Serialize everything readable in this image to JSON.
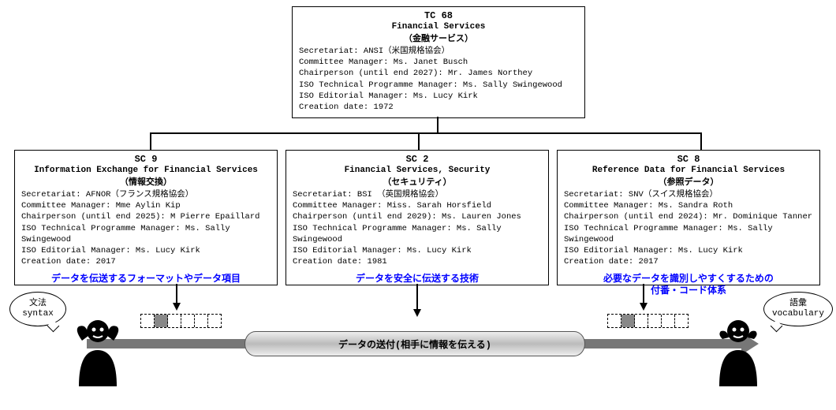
{
  "tc": {
    "code": "TC 68",
    "name_en": "Financial Services",
    "name_jp": "（金融サービス）",
    "body": "Secretariat: ANSI（米国規格協会）\nCommittee Manager: Ms. Janet Busch\nChairperson (until end 2027): Mr. James Northey\nISO Technical Programme Manager: Ms. Sally Swingewood\nISO Editorial Manager: Ms. Lucy Kirk\nCreation date: 1972"
  },
  "sc9": {
    "code": "SC 9",
    "name_en": "Information Exchange for Financial Services",
    "name_jp": "（情報交換）",
    "body": "Secretariat: AFNOR（フランス規格協会）\nCommittee Manager: Mme Aylin Kip\nChairperson (until end 2025): M Pierre Epaillard\nISO Technical Programme Manager: Ms. Sally Swingewood\nISO Editorial Manager: Ms. Lucy Kirk\nCreation date: 2017",
    "blue": "データを伝送するフォーマットやデータ項目"
  },
  "sc2": {
    "code": "SC 2",
    "name_en": "Financial Services, Security",
    "name_jp": "（セキュリティ）",
    "body": "Secretariat: BSI （英国規格協会）\nCommittee Manager: Miss. Sarah Horsfield\nChairperson (until end 2029): Ms. Lauren Jones\nISO Technical Programme Manager: Ms. Sally Swingewood\nISO Editorial Manager: Ms. Lucy Kirk\nCreation date: 1981",
    "blue": "データを安全に伝送する技術"
  },
  "sc8": {
    "code": "SC 8",
    "name_en": "Reference Data for Financial Services",
    "name_jp": "（参照データ）",
    "body": "Secretariat: SNV（スイス規格協会）\nCommittee Manager: Ms. Sandra Roth\nChairperson (until end 2024): Mr. Dominique Tanner\nISO Technical Programme Manager: Ms. Sally Swingewood\nISO Editorial Manager: Ms. Lucy Kirk\nCreation date: 2017",
    "blue": "必要なデータを識別しやすくするための\n付番・コード体系"
  },
  "persons": {
    "left_bubble_jp": "文法",
    "left_bubble_en": "syntax",
    "right_bubble_jp": "語彙",
    "right_bubble_en": "vocabulary"
  },
  "flow": {
    "pipe_label": "データの送付(相手に情報を伝える)"
  }
}
